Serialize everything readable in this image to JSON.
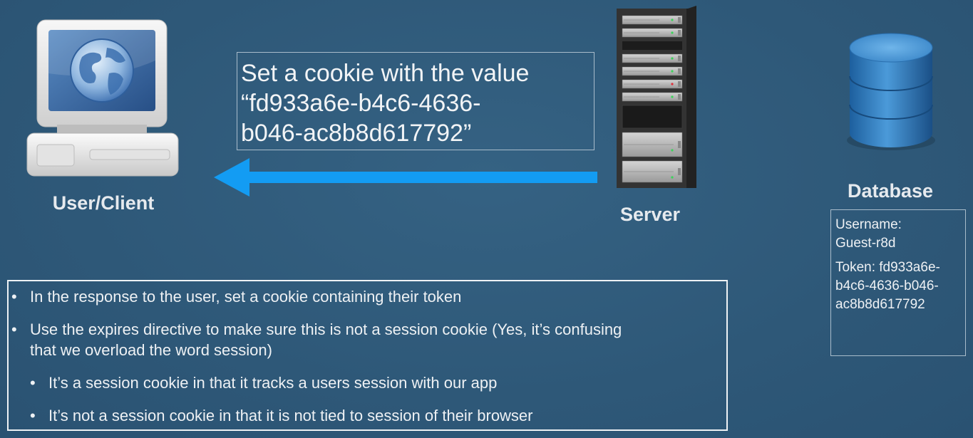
{
  "nodes": {
    "client_label": "User/Client",
    "server_label": "Server",
    "database_label": "Database"
  },
  "message": {
    "lines": [
      "Set a cookie with the value",
      "“fd933a6e-b4c6-4636-",
      "b046-ac8b8d617792”"
    ]
  },
  "database_record": {
    "username_lines": [
      "Username:",
      "Guest-r8d"
    ],
    "token_lines": [
      "Token: fd933a6e-",
      "b4c6-4636-b046-",
      "ac8b8d617792"
    ]
  },
  "bullets": [
    {
      "level": 1,
      "lines": [
        "In the response to the user, set a cookie containing their token"
      ]
    },
    {
      "level": 1,
      "lines": [
        "Use the expires directive to make sure this is not a session cookie (Yes, it’s confusing",
        "that we overload the word session)"
      ]
    },
    {
      "level": 2,
      "lines": [
        "It’s a session cookie in that it tracks a users session with our app"
      ]
    },
    {
      "level": 2,
      "lines": [
        "It’s not a session cookie in that it is not tied to session of their browser"
      ]
    }
  ],
  "colors": {
    "background": "#2f5a7a",
    "arrow": "#139cf3"
  },
  "icons": [
    "computer-icon",
    "server-rack-icon",
    "database-icon",
    "arrow-left-icon"
  ]
}
